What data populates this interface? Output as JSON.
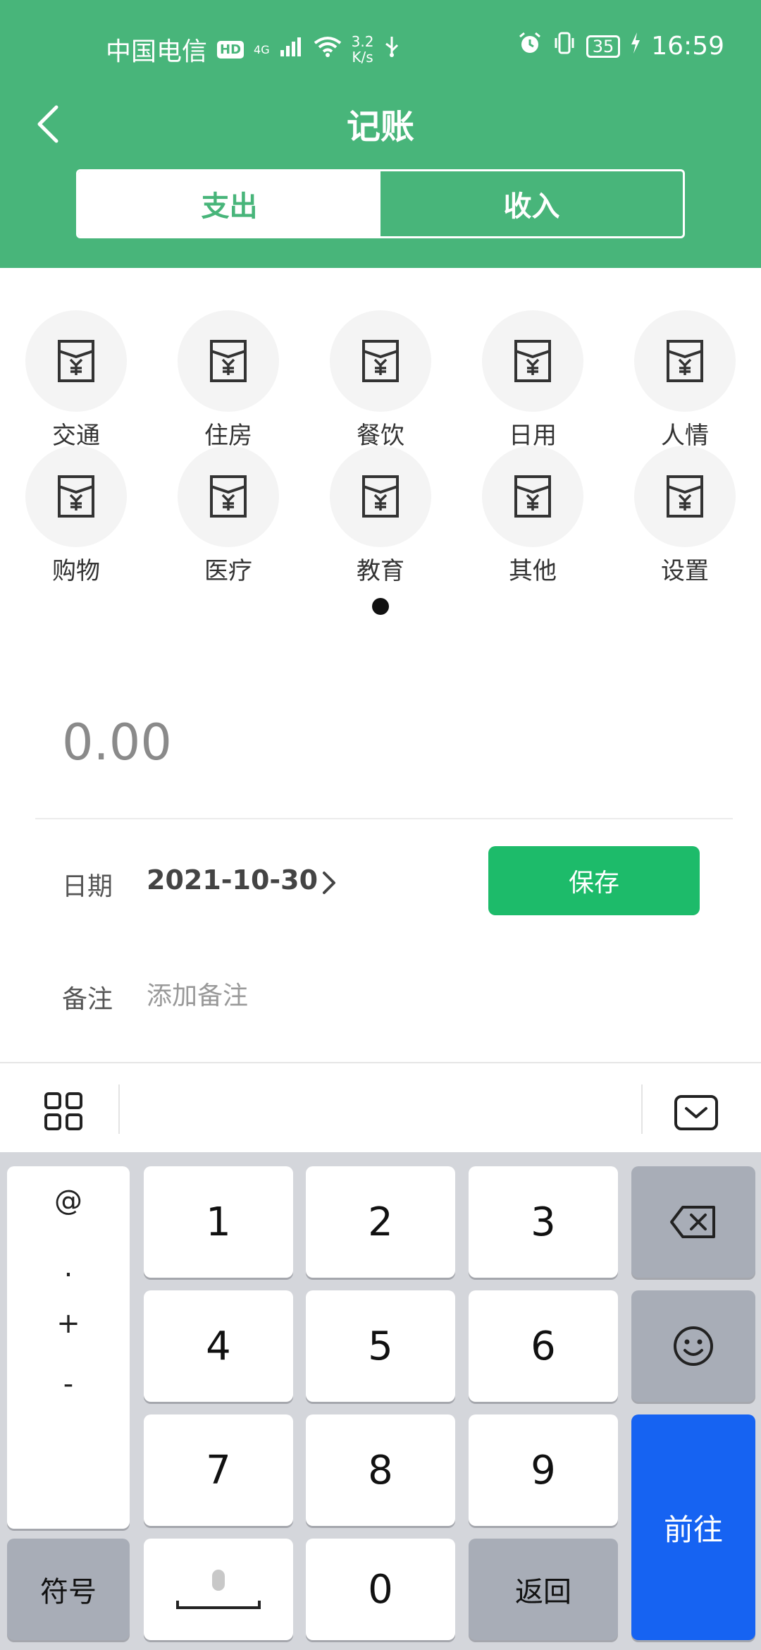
{
  "status_bar": {
    "carrier": "中国电信",
    "hd": "HD",
    "network": "4G",
    "speed_value": "3.2",
    "speed_unit": "K/s",
    "battery": "35",
    "time": "16:59"
  },
  "header": {
    "title": "记账",
    "tabs": [
      {
        "label": "支出",
        "active": true
      },
      {
        "label": "收入",
        "active": false
      }
    ]
  },
  "categories": [
    {
      "label": "交通",
      "icon": "wallet-icon"
    },
    {
      "label": "住房",
      "icon": "wallet-icon"
    },
    {
      "label": "餐饮",
      "icon": "wallet-icon"
    },
    {
      "label": "日用",
      "icon": "wallet-icon"
    },
    {
      "label": "人情",
      "icon": "wallet-icon"
    },
    {
      "label": "购物",
      "icon": "wallet-icon"
    },
    {
      "label": "医疗",
      "icon": "wallet-icon"
    },
    {
      "label": "教育",
      "icon": "wallet-icon"
    },
    {
      "label": "其他",
      "icon": "wallet-icon"
    },
    {
      "label": "设置",
      "icon": "wallet-icon"
    }
  ],
  "form": {
    "amount": "0.00",
    "date_label": "日期",
    "date_value": "2021-10-30",
    "save_label": "保存",
    "memo_label": "备注",
    "memo_placeholder": "添加备注"
  },
  "keyboard": {
    "side_keys": [
      "@",
      ".",
      "+",
      "-"
    ],
    "digits": [
      "1",
      "2",
      "3",
      "4",
      "5",
      "6",
      "7",
      "8",
      "9",
      "0"
    ],
    "symbols_label": "符号",
    "back_label": "返回",
    "go_label": "前往"
  },
  "colors": {
    "header_green": "#48b57a",
    "save_green": "#1dbb6a",
    "go_blue": "#1663f2"
  }
}
